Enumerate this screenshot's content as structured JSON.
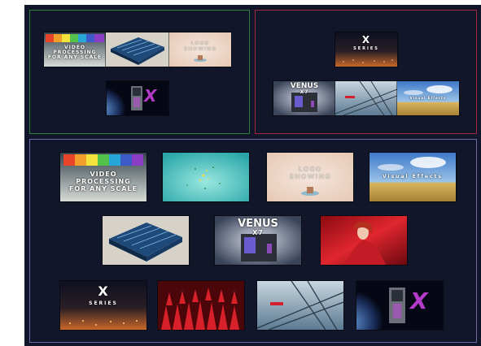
{
  "groups": [
    {
      "name": "group-top-left",
      "border_color": "#2e7d3e"
    },
    {
      "name": "group-top-right",
      "border_color": "#a3263a"
    },
    {
      "name": "group-bottom",
      "border_color": "#7467a8"
    }
  ],
  "thumbnails": {
    "video_processing": {
      "caption": "VIDEO\nPROCESSING\nFOR ANY SCALE",
      "icon": "color-led-strip"
    },
    "circuit_board": {
      "icon": "blue-circuit-board"
    },
    "logo_render": {
      "caption": "LOGO\nSHOWING",
      "icon": "pedestal-logo"
    },
    "venus_x7_globe": {
      "brand": "X",
      "icon": "venus-device-globe"
    },
    "x_series_city": {
      "title": "X",
      "subtitle": "SERIES",
      "icon": "night-city-lights"
    },
    "venus_x7": {
      "brand": "VENUS",
      "model": "X7",
      "icon": "venus-x7-device"
    },
    "bridge": {
      "badge": "",
      "icon": "steel-bridge"
    },
    "visual_effects": {
      "caption": "Visual Effects",
      "icon": "sky-field"
    },
    "particles": {
      "icon": "teal-particles"
    },
    "red_dress": {
      "icon": "red-dress-woman"
    },
    "red_seats": {
      "icon": "red-theater-seats"
    }
  },
  "colors": {
    "background": "#12162a",
    "accent_purple": "#b43ac8",
    "accent_red": "#d2202c"
  }
}
